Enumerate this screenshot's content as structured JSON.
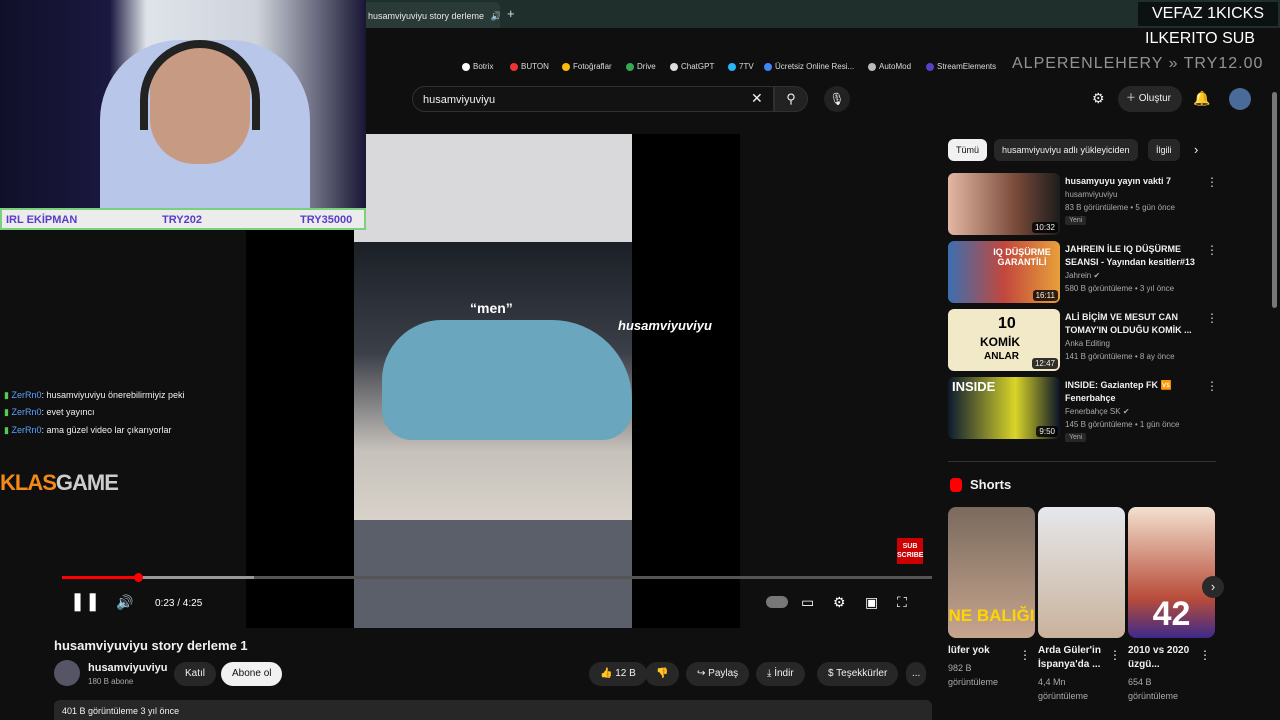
{
  "browser": {
    "tab_title": "husamviyuviyu story derleme",
    "new_tab": "+",
    "bookmarks": [
      "Botrix",
      "BUTON",
      "Fotoğraflar",
      "Drive",
      "ChatGPT",
      "7TV",
      "Ücretsiz Online Resi...",
      "AutoMod",
      "StreamElements"
    ],
    "bookmarks_more": "»"
  },
  "stream_overlay": {
    "sub_goal": "VEFAZ 1KICKS",
    "sub_line": "ILKERITO SUB",
    "donation_line": "ALPERENLEHERY  »  TRY12.00",
    "equipment_label": "IRL EKİPMAN",
    "equipment_price1": "TRY202",
    "equipment_price2": "TRY35000",
    "sponsor": "KLASGAME",
    "sponsor_part1": "KLAS",
    "sponsor_part2": "GAME"
  },
  "chat": [
    {
      "user": "ZerRn0",
      "msg": ": husamviyuviyu önerebilirmiyiz peki"
    },
    {
      "user": "ZerRn0",
      "msg": ": evet yayıncı"
    },
    {
      "user": "ZerRn0",
      "msg": ": ama güzel video lar çıkarıyorlar"
    }
  ],
  "youtube": {
    "search_value": "husamviyuviyu",
    "create_label": "Oluştur",
    "video": {
      "overlay_caption": "“men”",
      "watermark": "husamviyuviyu",
      "time": "0:23 / 4:25",
      "progress_fraction": 0.088,
      "subscribe_badge": "SUB SCRIBE",
      "title": "husamviyuviyu story derleme 1",
      "channel": "husamviyuviyu",
      "subscribers": "180 B abone",
      "join_label": "Katıl",
      "subscribe_label": "Abone ol",
      "likes": "12 B",
      "share_label": "Paylaş",
      "download_label": "İndir",
      "thanks_label": "Teşekkürler",
      "more_label": "...",
      "stats": "401 B görüntüleme  3 yıl önce"
    },
    "chips": [
      "Tümü",
      "husamviyuviyu adlı yükleyiciden",
      "İlgili"
    ],
    "recommendations": [
      {
        "title": "husamyuyu yayın vakti 7",
        "channel": "husamviyuviyu",
        "meta": "83 B görüntüleme • 5 gün önce",
        "duration": "10:32",
        "badge": "Yeni"
      },
      {
        "title": "JAHREIN İLE IQ DÜŞÜRME SEANSI - Yayından kesitler#13",
        "channel": "Jahrein",
        "meta": "580 B görüntüleme • 3 yıl önce",
        "duration": "16:11",
        "badge": ""
      },
      {
        "title": "ALİ BİÇİM VE MESUT CAN TOMAY'IN OLDUĞU KOMİK ...",
        "channel": "Anka Editing",
        "meta": "141 B görüntüleme • 8 ay önce",
        "duration": "12:47",
        "badge": ""
      },
      {
        "title": "INSIDE: Gaziantep FK 🆚 Fenerbahçe",
        "channel": "Fenerbahçe SK",
        "meta": "145 B görüntüleme • 1 gün önce",
        "duration": "9:50",
        "badge": "Yeni"
      }
    ],
    "thumb_texts": {
      "rec2": "IQ DÜŞÜRME GARANTİLİ",
      "rec3_a": "10",
      "rec3_b": "KOMİK",
      "rec3_c": "ANLAR",
      "rec4": "INSIDE"
    },
    "shorts_title": "Shorts",
    "shorts": [
      {
        "title": "lüfer yok",
        "views": "982 B görüntüleme",
        "thumb_text": "NE BALIĞI"
      },
      {
        "title": "Arda Güler'in İspanya'da ...",
        "views": "4,4 Mn görüntüleme",
        "thumb_text": ""
      },
      {
        "title": "2010 vs 2020 üzgü...",
        "views": "654 B görüntüleme",
        "thumb_text": "42"
      }
    ],
    "colors": {
      "accent": "#ff0000",
      "background": "#0f0f0f",
      "chip": "#272727"
    }
  }
}
